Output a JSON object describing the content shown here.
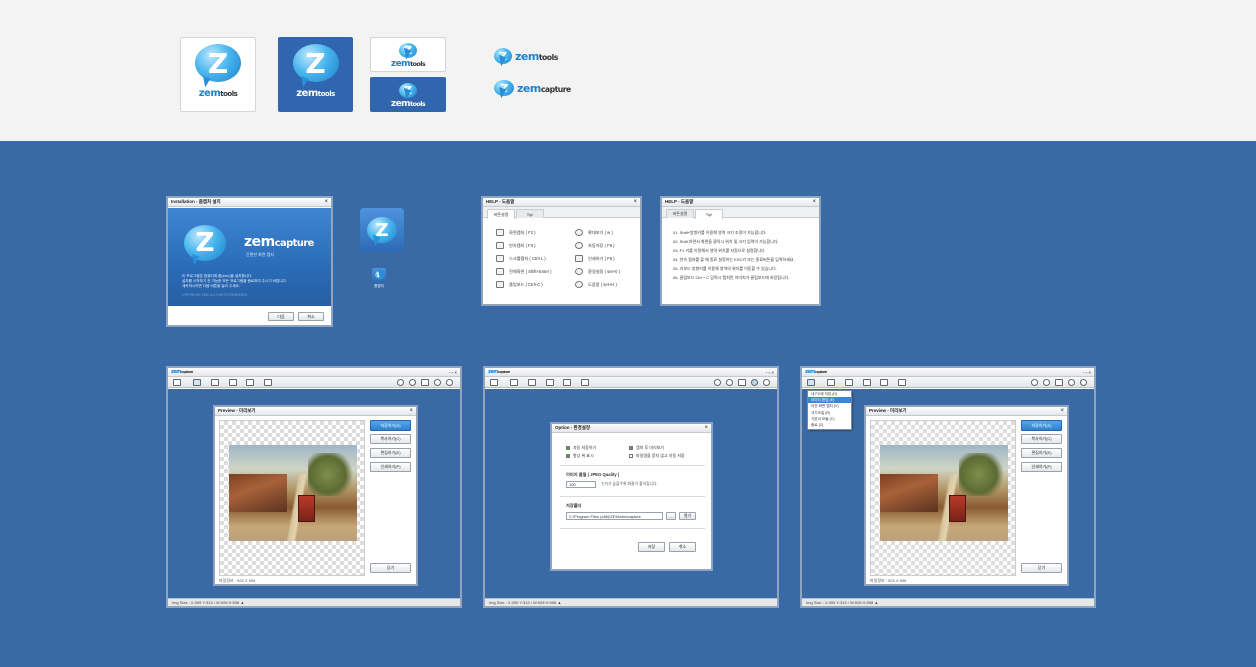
{
  "colors": {
    "top_bg": "#f3f3f3",
    "bottom_bg": "#3a6aa6",
    "accent": "#1d82cf",
    "primary_button": "#3b86d8"
  },
  "logos": {
    "z": "Z",
    "zem": "zem",
    "tools": "tools",
    "capture": "capture"
  },
  "install": {
    "title": "Installation - 줌캡처 설치",
    "tagline": "간편한 화면 캡처",
    "body1": "이 프로그램은 컴퓨터에 줌(zem)을 설치합니다.",
    "body2": "설치를 시작하기 전 가능한 모든 프로그램을 종료하여 주시기 바랍니다.",
    "body3": "계속하시려면 다음 버튼을 눌러 주세요.",
    "copyright": "COPYRIGHT ZEM. ALL RIGHTS RESERVED.",
    "next": "다음",
    "cancel": "취소",
    "shortcut_label": "줌캡처"
  },
  "help1": {
    "title": "HELP - 도움말",
    "tab1": "버튼설명",
    "tab2": "Tip!",
    "left": [
      "화면캡처 ( F2 )",
      "연속캡처 ( F3 )",
      "스크롤캡처 ( Ctrl+L )",
      "전체화면 ( Shift+Enter )",
      "클립보드 ( Ctrl+C )"
    ],
    "right": [
      "확대보기 ( w )",
      "자동저장 ( F5 )",
      "인쇄하기 ( F6 )",
      "환경설정 ( set+0 )",
      "도움말 ( set+H )"
    ]
  },
  "help2": {
    "title": "HELP - 도움말",
    "tab1": "버튼설명",
    "tab2": "Tip!",
    "tips": [
      "01. Shift+방향키를 이용해 영역 크기 조정이 가능합니다.",
      "02. Shift 하면서 화면을 클릭시 위치 및 크기 입력이 가능합니다.",
      "03. F1 키를 이용해서 영역 위치를 지정으로 설정합니다.",
      "04. 연속 캡처를 할 때 종료 설정하는 ESC키 또는 종료버튼을 입력하세요.",
      "05. 키보드 방향키를 이용해 영역의 위치를 이동할 수 있습니다.",
      "06. 클립보드 Ctrl + C 입력시 캡처된 이미지가 클립보드에 저장됩니다."
    ]
  },
  "app": {
    "brand": "zem",
    "brand_suffix": "capture",
    "win_controls": "- ▫ ×",
    "status": "Img Size : X:399 Y:313 / W:928 H:598 ▲",
    "preview_title": "Preview - 미리보기",
    "buttons": [
      "저장하기(S)",
      "복사하기(C)",
      "편집하기(E)",
      "인쇄하기(P)"
    ],
    "close": "닫기",
    "file_info": "파일정보 : 925 X 596"
  },
  "option": {
    "title": "Option - 환경설정",
    "checks": [
      {
        "label": "자동 저장하기",
        "on": true
      },
      {
        "label": "캡처 후 미리보기",
        "on": true
      },
      {
        "label": "항상 위 표시",
        "on": true
      },
      {
        "label": "파일명을 묻지 않고 자동 저장",
        "on": false
      }
    ],
    "quality_title": "이미지 품질 ( JPEG Quality )",
    "quality_value": "100",
    "quality_note": "숫자가 높을수록 화질이 좋아집니다.",
    "folder_title": "저장폴더",
    "folder_value": "C:\\Program Files (x86)\\ZEM\\zemcapture",
    "browse": "...",
    "open": "열기",
    "save": "저장",
    "cancel": "취소"
  },
  "menu": {
    "items": [
      "내 PC에 저장 (D)",
      "이미지 편집 (E)",
      "이전 화면 캡처 (V)",
      "크기조절 (R)",
      "기본이 모듈 (C)",
      "종료 (Z)"
    ],
    "selected": 1
  }
}
